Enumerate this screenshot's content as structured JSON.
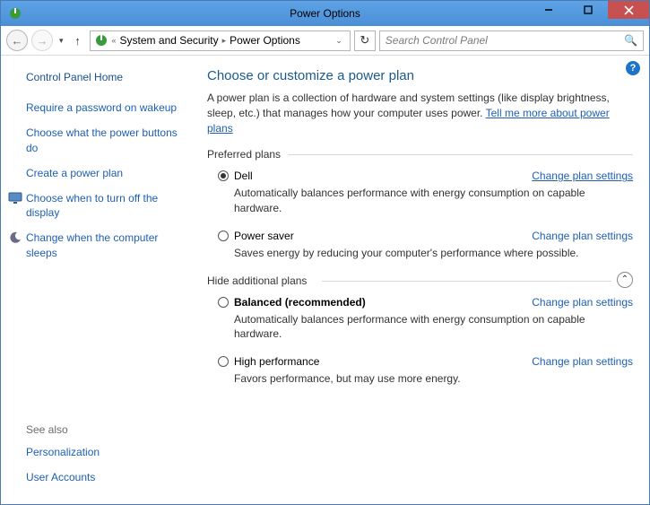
{
  "window": {
    "title": "Power Options"
  },
  "toolbar": {
    "breadcrumb": {
      "seg1": "System and Security",
      "seg2": "Power Options"
    },
    "search_placeholder": "Search Control Panel"
  },
  "sidebar": {
    "home": "Control Panel Home",
    "links": {
      "require_pw": "Require a password on wakeup",
      "buttons": "Choose what the power buttons do",
      "create": "Create a power plan",
      "display_off": "Choose when to turn off the display",
      "sleep": "Change when the computer sleeps"
    },
    "see_also_label": "See also",
    "see_also": {
      "personalization": "Personalization",
      "accounts": "User Accounts"
    }
  },
  "main": {
    "heading": "Choose or customize a power plan",
    "desc_before": "A power plan is a collection of hardware and system settings (like display brightness, sleep, etc.) that manages how your computer uses power. ",
    "desc_link": "Tell me more about power plans",
    "preferred_label": "Preferred plans",
    "hide_label": "Hide additional plans",
    "change_link": "Change plan settings",
    "plans": {
      "p1": {
        "name": "Dell",
        "desc": "Automatically balances performance with energy consumption on capable hardware."
      },
      "p2": {
        "name": "Power saver",
        "desc": "Saves energy by reducing your computer's performance where possible."
      },
      "p3": {
        "name": "Balanced (recommended)",
        "desc": "Automatically balances performance with energy consumption on capable hardware."
      },
      "p4": {
        "name": "High performance",
        "desc": "Favors performance, but may use more energy."
      }
    }
  }
}
